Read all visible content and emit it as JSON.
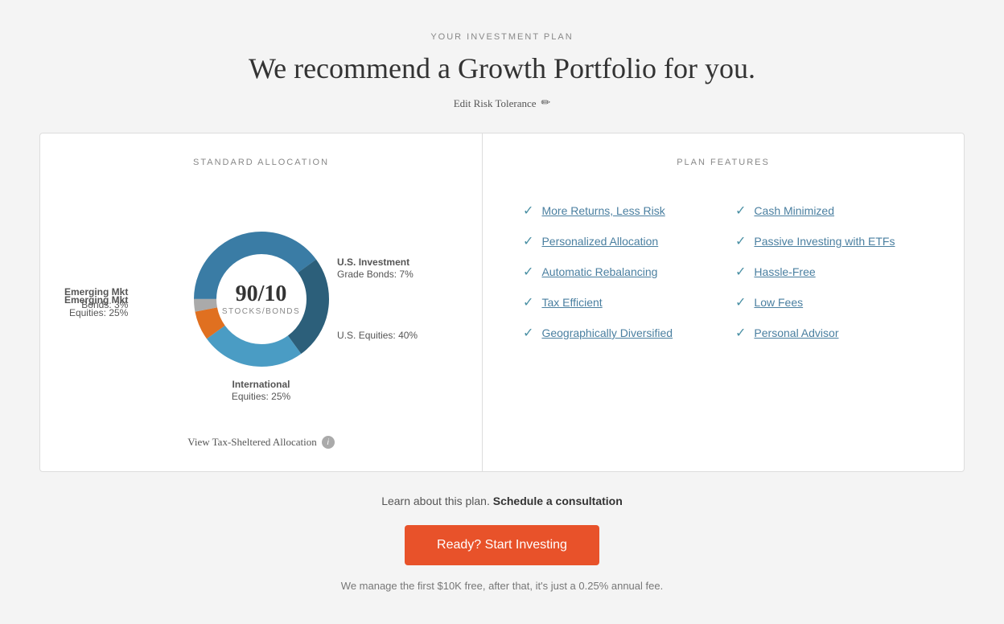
{
  "page": {
    "section_label": "YOUR INVESTMENT PLAN",
    "main_title": "We recommend a Growth Portfolio for you.",
    "edit_risk_label": "Edit Risk Tolerance",
    "edit_risk_icon": "✏"
  },
  "left_panel": {
    "title": "STANDARD ALLOCATION",
    "donut_ratio": "90/10",
    "donut_sublabel": "STOCKS/BONDS",
    "segments": [
      {
        "label": "U.S. Equities: 40%",
        "pct": 40,
        "color": "#3a7ca5"
      },
      {
        "label": "Emerging Mkt Equities: 25%",
        "pct": 25,
        "color": "#2c5f7a"
      },
      {
        "label": "International Equities: 25%",
        "pct": 25,
        "color": "#4a9cc4"
      },
      {
        "label": "U.S. Investment Grade Bonds: 7%",
        "pct": 7,
        "color": "#e07020"
      },
      {
        "label": "Emerging Mkt Bonds: 3%",
        "pct": 3,
        "color": "#c0c0c0"
      }
    ],
    "view_tax_label": "View Tax-Sheltered Allocation"
  },
  "right_panel": {
    "title": "PLAN FEATURES",
    "features_col1": [
      "More Returns, Less Risk",
      "Personalized Allocation",
      "Automatic Rebalancing",
      "Tax Efficient",
      "Geographically Diversified"
    ],
    "features_col2": [
      "Cash Minimized",
      "Passive Investing with ETFs",
      "Hassle-Free",
      "Low Fees",
      "Personal Advisor"
    ]
  },
  "footer": {
    "learn_text": "Learn about this plan.",
    "schedule_label": "Schedule a consultation",
    "cta_label": "Ready? Start Investing",
    "fee_text": "We manage the first $10K free, after that, it's just a 0.25% annual fee."
  }
}
